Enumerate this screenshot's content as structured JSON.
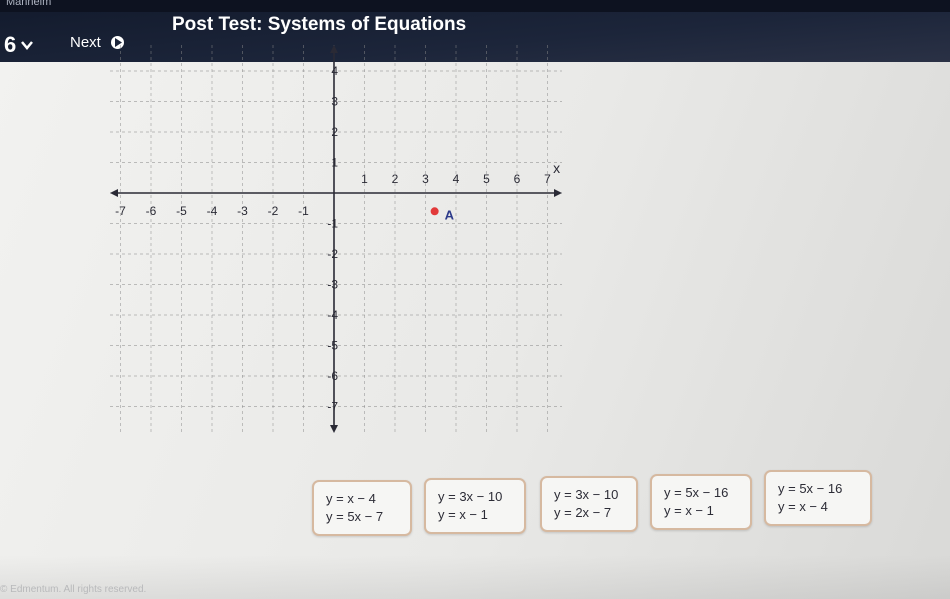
{
  "header": {
    "top_strip_text": "Mannelm",
    "question_number": "6",
    "next_label": "Next",
    "title": "Post Test: Systems of Equations"
  },
  "graph": {
    "x_axis_label": "x",
    "x_ticks": [
      "-7",
      "-6",
      "-5",
      "-4",
      "-3",
      "-2",
      "-1",
      "1",
      "2",
      "3",
      "4",
      "5",
      "6",
      "7"
    ],
    "y_ticks_positive": [
      "4",
      "3",
      "2",
      "1"
    ],
    "y_ticks_negative": [
      "-1",
      "-2",
      "-3",
      "-4",
      "-5",
      "-6",
      "-7"
    ],
    "point": {
      "label": "A",
      "x": 3.3,
      "y": -0.6,
      "color": "#e23a3a"
    },
    "grid_color": "#8a8a8a",
    "axis_color": "#2a2a35"
  },
  "options": [
    {
      "line1": "y = x − 4",
      "line2": "y = 5x − 7"
    },
    {
      "line1": "y = 3x − 10",
      "line2": "y = x − 1"
    },
    {
      "line1": "y = 3x − 10",
      "line2": "y = 2x − 7"
    },
    {
      "line1": "y = 5x − 16",
      "line2": "y = x − 1"
    },
    {
      "line1": "y = 5x − 16",
      "line2": "y = x − 4"
    }
  ],
  "footer": {
    "text": "© Edmentum. All rights reserved."
  }
}
